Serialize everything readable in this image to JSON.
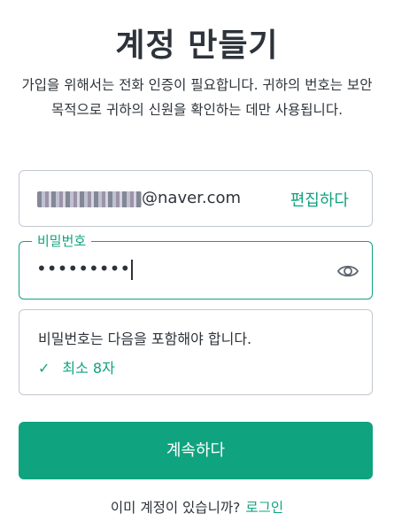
{
  "title": "계정 만들기",
  "subtitle": "가입을 위해서는 전화 인증이 필요합니다. 귀하의 번호는 보안 목적으로 귀하의 신원을 확인하는 데만 사용됩니다.",
  "email": {
    "domain": "@naver.com",
    "edit_label": "편집하다"
  },
  "password": {
    "label": "비밀번호",
    "value_masked": "•••••••••",
    "toggle_icon": "eye-icon"
  },
  "requirements": {
    "title": "비밀번호는 다음을 포함해야 합니다.",
    "items": [
      {
        "icon": "check-icon",
        "check": "✓",
        "text": "최소 8자"
      }
    ]
  },
  "continue_label": "계속하다",
  "footer": {
    "prompt": "이미 계정이 있습니까?",
    "login_label": "로그인"
  },
  "colors": {
    "accent": "#10a37f",
    "text": "#2d333a",
    "border": "#c2c8d0"
  }
}
